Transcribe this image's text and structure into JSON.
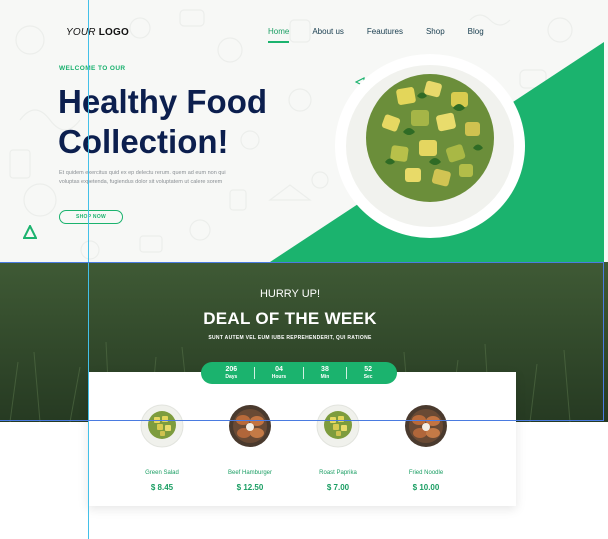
{
  "header": {
    "logo_prefix": "YOUR",
    "logo_suffix": "LOGO",
    "nav": [
      {
        "label": "Home",
        "active": true
      },
      {
        "label": "About us",
        "active": false
      },
      {
        "label": "Feautures",
        "active": false
      },
      {
        "label": "Shop",
        "active": false
      },
      {
        "label": "Blog",
        "active": false
      }
    ]
  },
  "hero": {
    "kicker": "WELCOME TO OUR",
    "title_line1": "Healthy Food",
    "title_line2": "Collection!",
    "description": "Et quidem exercitus quid ex ep delectu rerum. quem ad eum non qui voluptas expetenda, fugiendus dolor sit voluptatem ut calere sorem",
    "button": "SHOP NOW"
  },
  "deal": {
    "hurry": "HURRY UP!",
    "title": "DEAL OF THE WEEK",
    "subtitle": "SUNT AUTEM VEL EUM IUBE REPREHENDERIT, QUI RATIONE",
    "timer": [
      {
        "value": "206",
        "label": "Days"
      },
      {
        "value": "04",
        "label": "Hours"
      },
      {
        "value": "38",
        "label": "Min"
      },
      {
        "value": "52",
        "label": "Sec"
      }
    ]
  },
  "products": [
    {
      "name": "Green Salad",
      "price": "$ 8.45",
      "icon": "salad-bowl-icon"
    },
    {
      "name": "Beef Hamburger",
      "price": "$ 12.50",
      "icon": "meat-plate-icon"
    },
    {
      "name": "Roast Paprika",
      "price": "$ 7.00",
      "icon": "salad-bowl-icon"
    },
    {
      "name": "Fried Noodle",
      "price": "$ 10.00",
      "icon": "meat-plate-icon"
    }
  ],
  "colors": {
    "accent": "#1bb36e",
    "title": "#0c1f4e",
    "band": "#2f452a",
    "guide": "#43c0e8"
  }
}
